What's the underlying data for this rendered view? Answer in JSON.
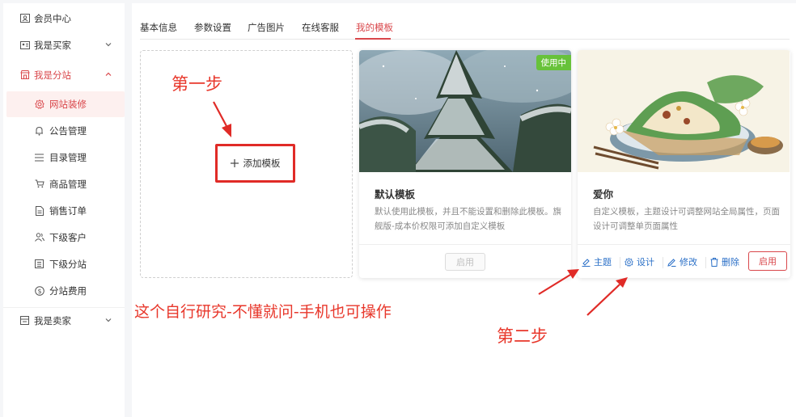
{
  "sidebar": {
    "items": [
      {
        "label": "会员中心",
        "icon": "id-card-icon"
      },
      {
        "label": "我是买家",
        "icon": "contact-card-icon"
      },
      {
        "label": "我是分站",
        "icon": "store-icon"
      },
      {
        "label": "网站装修",
        "icon": "gear-icon"
      },
      {
        "label": "公告管理",
        "icon": "bell-icon"
      },
      {
        "label": "目录管理",
        "icon": "list-icon"
      },
      {
        "label": "商品管理",
        "icon": "cart-icon"
      },
      {
        "label": "销售订单",
        "icon": "document-icon"
      },
      {
        "label": "下级客户",
        "icon": "users-icon"
      },
      {
        "label": "下级分站",
        "icon": "building-icon"
      },
      {
        "label": "分站费用",
        "icon": "dollar-circle-icon"
      },
      {
        "label": "我是卖家",
        "icon": "seller-icon"
      }
    ]
  },
  "tabs": [
    "基本信息",
    "参数设置",
    "广告图片",
    "在线客服",
    "我的模板"
  ],
  "add_template": {
    "label": "添加模板",
    "icon": "plus-icon"
  },
  "cards": [
    {
      "title": "默认模板",
      "desc": "默认使用此模板，并且不能设置和删除此模板。旗舰版-成本价权限可添加自定义模板",
      "badge": "使用中",
      "button": "启用"
    },
    {
      "title": "爱你",
      "desc": "自定义模板，主题设计可调整网站全局属性，页面设计可调整单页面属性",
      "actions": {
        "theme": "主题",
        "design": "设计",
        "edit": "修改",
        "delete": "删除"
      },
      "button": "启用"
    }
  ],
  "annotations": {
    "step1": "第一步",
    "step2": "第二步",
    "note": "这个自行研究-不懂就问-手机也可操作"
  },
  "colors": {
    "accent": "#d9474b",
    "annotation": "#e8372b",
    "badge": "#67c23a",
    "link": "#2a6fc7"
  }
}
